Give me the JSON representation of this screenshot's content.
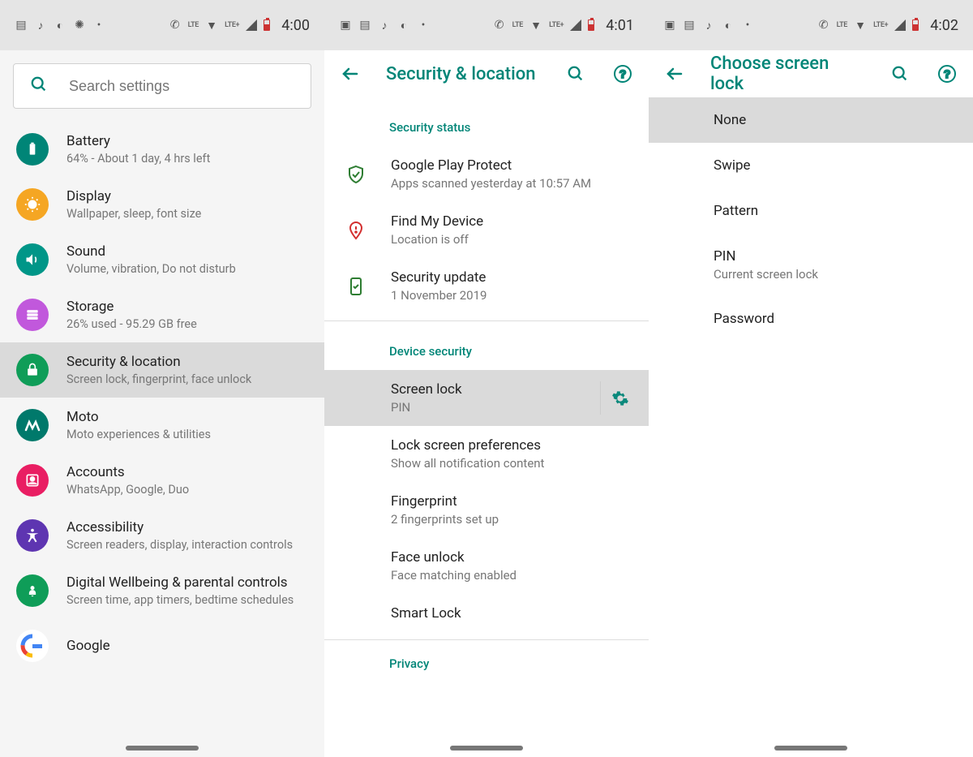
{
  "phone1": {
    "status": {
      "time": "4:00"
    },
    "search": {
      "placeholder": "Search settings"
    },
    "items": [
      {
        "icon": "battery-icon",
        "color": "#008577",
        "title": "Battery",
        "sub": "64% - About 1 day, 4 hrs left"
      },
      {
        "icon": "display-icon",
        "color": "#f5a623",
        "title": "Display",
        "sub": "Wallpaper, sleep, font size"
      },
      {
        "icon": "sound-icon",
        "color": "#009688",
        "title": "Sound",
        "sub": "Volume, vibration, Do not disturb"
      },
      {
        "icon": "storage-icon",
        "color": "#c158dc",
        "title": "Storage",
        "sub": "26% used - 95.29 GB free"
      },
      {
        "icon": "lock-icon",
        "color": "#0f9d58",
        "title": "Security & location",
        "sub": "Screen lock, fingerprint, face unlock",
        "selected": true
      },
      {
        "icon": "moto-icon",
        "color": "#00796b",
        "title": "Moto",
        "sub": "Moto experiences & utilities"
      },
      {
        "icon": "accounts-icon",
        "color": "#e91e63",
        "title": "Accounts",
        "sub": "WhatsApp, Google, Duo"
      },
      {
        "icon": "accessibility-icon",
        "color": "#5e35b1",
        "title": "Accessibility",
        "sub": "Screen readers, display, interaction controls"
      },
      {
        "icon": "wellbeing-icon",
        "color": "#0f9d58",
        "title": "Digital Wellbeing & parental controls",
        "sub": "Screen time, app timers, bedtime schedules"
      },
      {
        "icon": "google-icon",
        "color": "#ffffff",
        "title": "Google",
        "sub": ""
      }
    ]
  },
  "phone2": {
    "status": {
      "time": "4:01"
    },
    "appbar": {
      "title": "Security & location"
    },
    "sections": [
      {
        "header": "Security status",
        "items": [
          {
            "icon": "shield-check-icon",
            "iconColor": "#2e7d32",
            "title": "Google Play Protect",
            "sub": "Apps scanned yesterday at 10:57 AM"
          },
          {
            "icon": "location-alert-icon",
            "iconColor": "#d32f2f",
            "title": "Find My Device",
            "sub": "Location is off"
          },
          {
            "icon": "phone-check-icon",
            "iconColor": "#2e7d32",
            "title": "Security update",
            "sub": "1 November 2019"
          }
        ]
      },
      {
        "header": "Device security",
        "items": [
          {
            "title": "Screen lock",
            "sub": "PIN",
            "selected": true,
            "gear": true
          },
          {
            "title": "Lock screen preferences",
            "sub": "Show all notification content"
          },
          {
            "title": "Fingerprint",
            "sub": "2 fingerprints set up"
          },
          {
            "title": "Face unlock",
            "sub": "Face matching enabled"
          },
          {
            "title": "Smart Lock",
            "sub": ""
          }
        ]
      }
    ],
    "extraHeader": "Privacy"
  },
  "phone3": {
    "status": {
      "time": "4:02"
    },
    "appbar": {
      "title": "Choose screen lock"
    },
    "items": [
      {
        "title": "None",
        "sub": "",
        "selected": true
      },
      {
        "title": "Swipe",
        "sub": ""
      },
      {
        "title": "Pattern",
        "sub": ""
      },
      {
        "title": "PIN",
        "sub": "Current screen lock"
      },
      {
        "title": "Password",
        "sub": ""
      }
    ]
  }
}
